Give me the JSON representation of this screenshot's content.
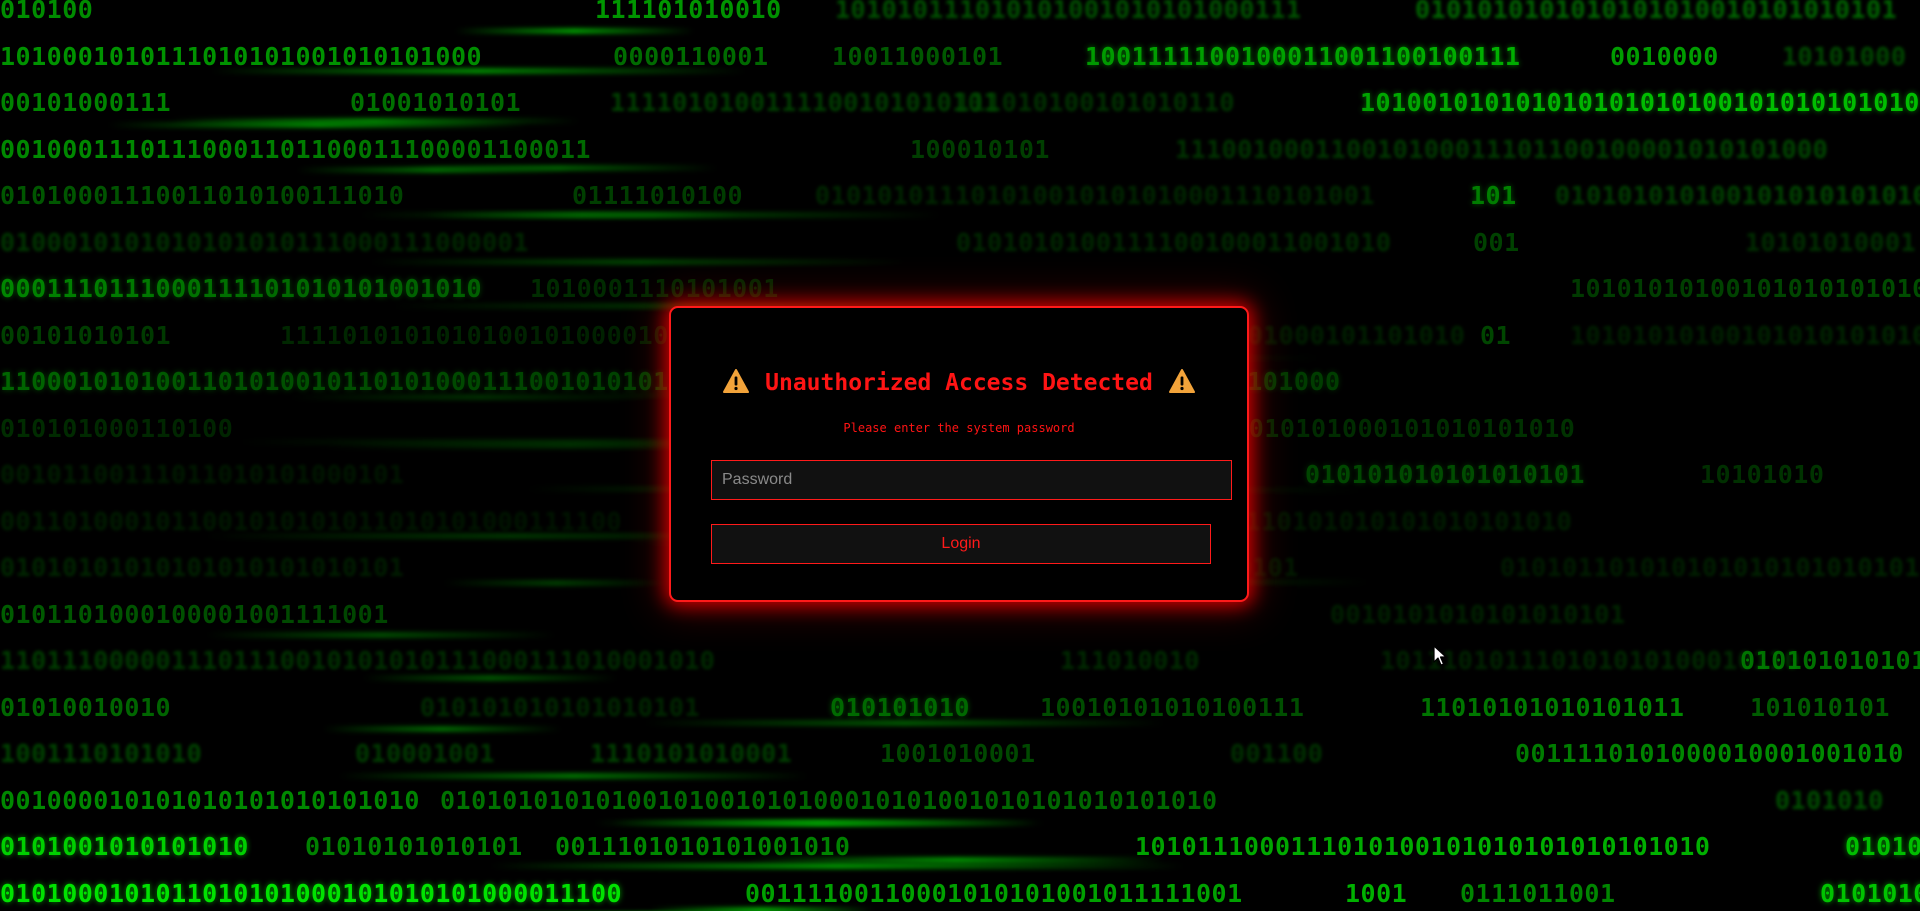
{
  "dialog": {
    "title": "Unauthorized Access Detected",
    "subtitle": "Please enter the system password",
    "warning_icon": "warning-triangle-icon",
    "password_placeholder": "Password",
    "login_label": "Login"
  },
  "background": {
    "style": "binary matrix rain",
    "color": "#00ff00",
    "rows": [
      [
        "010100",
        "111101010010",
        "101010111010101001010101000111",
        "0101010101010101010010101010101"
      ],
      [
        "1010001010111010101001010101000",
        "0000110001",
        "10011000101",
        "1001111100100011001100100111",
        "0010000",
        "10101000"
      ],
      [
        "00101000111",
        "01001010101",
        "1111010100111100101010101",
        "111010100101010110",
        "101001010101010101010100101010101010"
      ],
      [
        "00100011101110001101100011100001100011",
        "100010101",
        "111001000110010100011101100100001010101000"
      ],
      [
        "01010001110011010100111010",
        "01111010100",
        "010101011101010010101010001110101001",
        "101",
        "0101010101001010101010101"
      ],
      [
        "0100010101010101010111000111000001",
        "0101010100111100100011001010",
        "001",
        "10101010001"
      ],
      [
        "0001110111000111101010101001010",
        "1010001110101001",
        "10101010100101010101010101"
      ],
      [
        "00101010101",
        "111101010101010010100001011101",
        "001000101101010",
        "01",
        "10101010100101010101010"
      ],
      [
        "11000101010011010100101101010001110010101011000111010",
        "1010101000"
      ],
      [
        "010101000110100",
        "0101010101000101010101010001000101010101000101010101010"
      ],
      [
        "00101100111011010101000101",
        "010101010101010101",
        "10101010"
      ],
      [
        "0011010001011001010101011010101000111100",
        "1110101010101010101010"
      ],
      [
        "01010101010101010101010101",
        "0101010100101011010100101",
        "010101101010101010101010101"
      ],
      [
        "0101101000100001001111001",
        "0010101010101010101"
      ],
      [
        "1101110000011101110010101010111000111010001010",
        "111010010",
        "101110101110101010100010110",
        "010101010101010101001010101010"
      ],
      [
        "01010010010",
        "010101010101010101",
        "010101010",
        "10010101010100111",
        "11010101010101011",
        "101010101"
      ],
      [
        "1001110101010",
        "010001001",
        "1110101010001",
        "1001010001",
        "001100",
        "0011110101000010001001010"
      ],
      [
        "001000010101010101010101010",
        "01010101010100101001010100010101001010101010101010",
        "0101010"
      ],
      [
        "0101001010101010",
        "01010101010101",
        "0011101010101001010",
        "1010111000111010100101010101010101010",
        "010101"
      ],
      [
        "0101000101011010101000101010101000011100",
        "00111100110001010101001011111001",
        "1001",
        "0111011001",
        "010101000"
      ]
    ]
  }
}
